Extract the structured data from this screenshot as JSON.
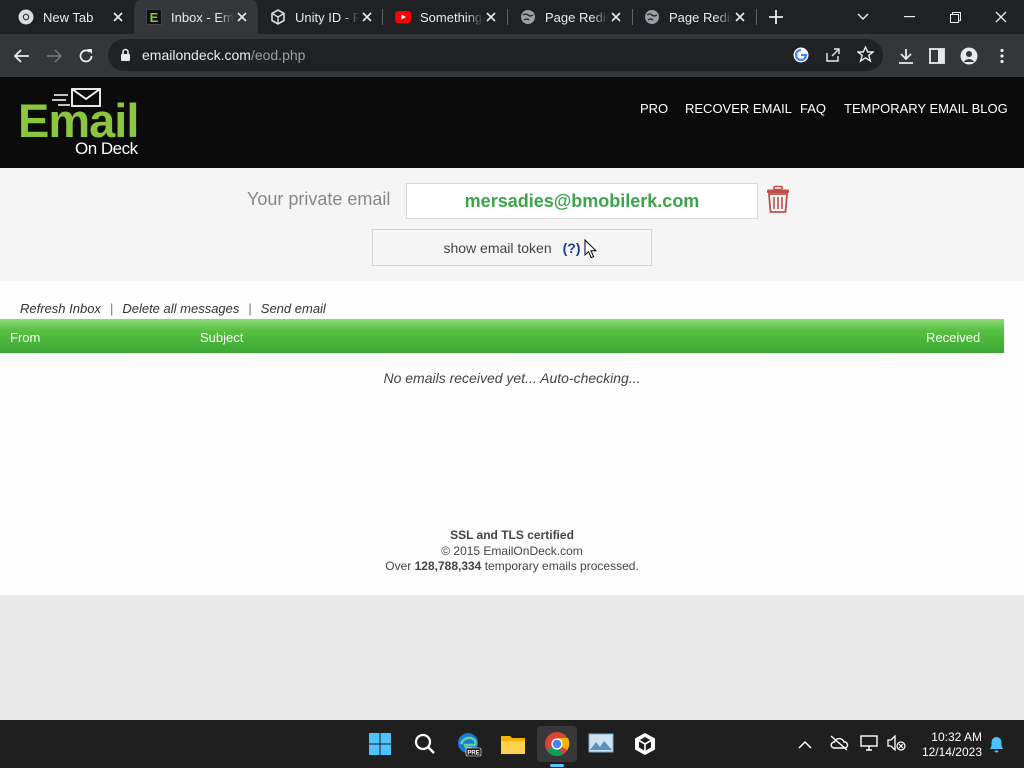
{
  "browser": {
    "tabs": [
      {
        "title": "New Tab",
        "icon": "chrome-icon",
        "active": false
      },
      {
        "title": "Inbox - EmailOnDeck",
        "icon": "emailondeck-favicon",
        "active": true
      },
      {
        "title": "Unity ID - Privacy",
        "icon": "unity-icon",
        "active": false
      },
      {
        "title": "Something",
        "icon": "youtube-icon",
        "active": false
      },
      {
        "title": "Page Redirection",
        "icon": "globe-icon",
        "active": false
      },
      {
        "title": "Page Redirection",
        "icon": "globe-icon",
        "active": false
      }
    ],
    "url_domain": "emailondeck.com",
    "url_path": "/eod.php"
  },
  "site": {
    "logo_word": "Email",
    "logo_sub": "On Deck",
    "nav": [
      "PRO",
      "RECOVER EMAIL",
      "FAQ",
      "TEMPORARY EMAIL BLOG"
    ]
  },
  "email_panel": {
    "label": "Your private email",
    "address": "mersadies@bmobilerk.com",
    "token_button": "show email token",
    "token_help": "(?)"
  },
  "inbox": {
    "actions": [
      "Refresh Inbox",
      "Delete all messages",
      "Send email"
    ],
    "columns": [
      "From",
      "Subject",
      "Received"
    ],
    "empty_message": "No emails received yet... Auto-checking..."
  },
  "footer": {
    "certified": "SSL and TLS certified",
    "copyright": "© 2015 EmailOnDeck.com",
    "processed_prefix": "Over",
    "processed_count": "128,788,334",
    "processed_suffix": "temporary emails processed."
  },
  "taskbar": {
    "time": "10:32 AM",
    "date": "12/14/2023"
  },
  "colors": {
    "brand_green": "#8cc63f",
    "email_green": "#3aa549",
    "header_bg": "#0b0b0b"
  }
}
